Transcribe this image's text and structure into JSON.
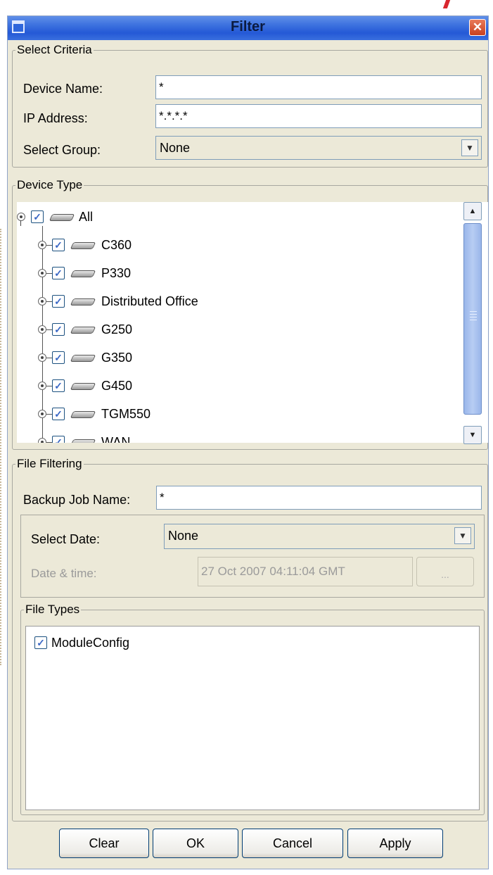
{
  "window": {
    "title": "Filter",
    "close_glyph": "✕"
  },
  "select_criteria": {
    "legend": "Select Criteria",
    "device_name_label": "Device Name:",
    "device_name_value": "*",
    "ip_address_label": "IP Address:",
    "ip_address_value": "*.*.*.*",
    "select_group_label": "Select Group:",
    "select_group_value": "None"
  },
  "device_type": {
    "legend": "Device Type",
    "root": {
      "label": "All",
      "checked": true
    },
    "items": [
      {
        "label": "C360",
        "checked": true
      },
      {
        "label": "P330",
        "checked": true
      },
      {
        "label": "Distributed Office",
        "checked": true
      },
      {
        "label": "G250",
        "checked": true
      },
      {
        "label": "G350",
        "checked": true
      },
      {
        "label": "G450",
        "checked": true
      },
      {
        "label": "TGM550",
        "checked": true
      },
      {
        "label": "WAN",
        "checked": true
      }
    ],
    "check_glyph": "✓",
    "scroll_up_glyph": "▲",
    "scroll_down_glyph": "▼"
  },
  "file_filtering": {
    "legend": "File Filtering",
    "backup_job_label": "Backup Job Name:",
    "backup_job_value": "*",
    "select_date_label": "Select Date:",
    "select_date_value": "None",
    "date_time_label": "Date & time:",
    "date_time_value": "27 Oct 2007 04:11:04 GMT",
    "date_picker_button": "...",
    "file_types": {
      "legend": "File Types",
      "items": [
        {
          "label": "ModuleConfig",
          "checked": true
        }
      ]
    }
  },
  "buttons": {
    "clear": "Clear",
    "ok": "OK",
    "cancel": "Cancel",
    "apply": "Apply"
  },
  "colors": {
    "title_bar": "#2459d6",
    "dialog_bg": "#ece9d8",
    "check_mark": "#3b68c5",
    "close_button": "#c9401e"
  }
}
